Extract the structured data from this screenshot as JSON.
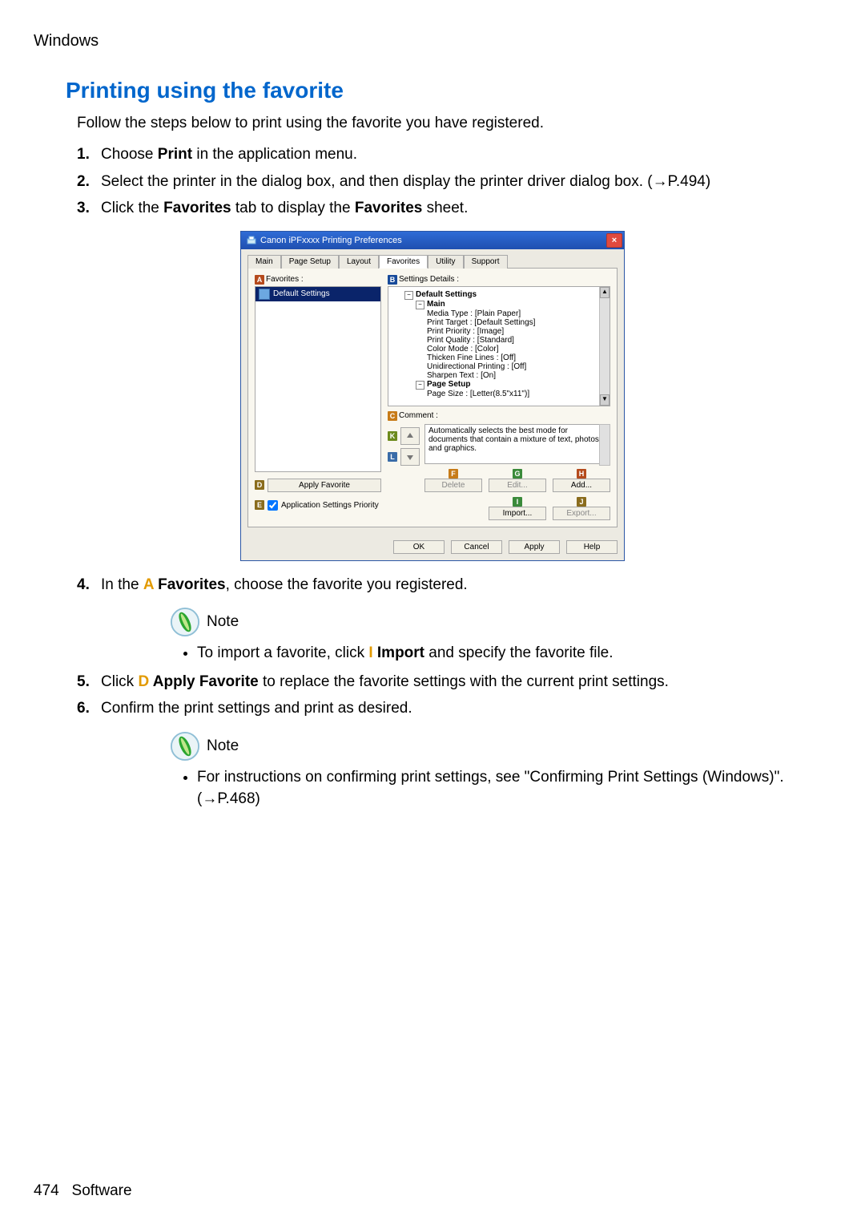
{
  "top_path": "Windows",
  "heading": "Printing using the favorite",
  "intro": "Follow the steps below to print using the favorite you have registered.",
  "steps": {
    "s1": {
      "num": "1.",
      "pre": "Choose ",
      "bold": "Print",
      "post": " in the application menu."
    },
    "s2": {
      "num": "2.",
      "text": "Select the printer in the dialog box, and then display the printer driver dialog box.  (",
      "arrow": "→P.494",
      "close": ")"
    },
    "s3": {
      "num": "3.",
      "pre": "Click the ",
      "b1": "Favorites",
      "mid": " tab to display the ",
      "b2": "Favorites",
      "post": " sheet."
    },
    "s4": {
      "num": "4.",
      "pre": "In the ",
      "markerA": "A",
      "b": " Favorites",
      "post": ", choose the favorite you registered."
    },
    "s5": {
      "num": "5.",
      "pre": "Click ",
      "markerD": "D",
      "b": " Apply Favorite",
      "post": " to replace the favorite settings with the current print settings."
    },
    "s6": {
      "num": "6.",
      "text": "Confirm the print settings and print as desired."
    }
  },
  "notes": {
    "label": "Note",
    "n1": {
      "pre": "To import a favorite, click ",
      "markerI": "I",
      "b": " Import",
      "post": " and specify the favorite file."
    },
    "n2": {
      "pre": "For instructions on confirming print settings, see \"Confirming Print Settings (Windows)\".  (",
      "arrow": "→P.468",
      "close": ")"
    }
  },
  "footer": {
    "page": "474",
    "section": "Software"
  },
  "dialog": {
    "title": "Canon iPFxxxx Printing Preferences",
    "tabs": [
      "Main",
      "Page Setup",
      "Layout",
      "Favorites",
      "Utility",
      "Support"
    ],
    "active_tab_index": 3,
    "labels": {
      "favorites": "Favorites :",
      "settings_details": "Settings Details :",
      "comment": "Comment :",
      "apply_favorite": "Apply Favorite",
      "app_settings_priority": "Application Settings Priority"
    },
    "markers": {
      "A": "A",
      "B": "B",
      "C": "C",
      "D": "D",
      "E": "E",
      "F": "F",
      "G": "G",
      "H": "H",
      "I": "I",
      "J": "J",
      "K": "K",
      "L": "L"
    },
    "favorites_list": [
      "Default Settings"
    ],
    "tree": {
      "root": "Default Settings",
      "main": "Main",
      "leaves": [
        "Media Type : [Plain Paper]",
        "Print Target : [Default Settings]",
        "Print Priority : [Image]",
        "Print Quality : [Standard]",
        "Color Mode : [Color]",
        "Thicken Fine Lines : [Off]",
        "Unidirectional Printing : [Off]",
        "Sharpen Text : [On]"
      ],
      "page_setup": "Page Setup",
      "page_size": "Page Size : [Letter(8.5\"x11\")]"
    },
    "comment_text": "Automatically selects the best mode for documents that contain a mixture of text, photos, and graphics.",
    "buttons": {
      "delete": "Delete",
      "edit": "Edit...",
      "add": "Add...",
      "import": "Import...",
      "export": "Export...",
      "ok": "OK",
      "cancel": "Cancel",
      "apply": "Apply",
      "help": "Help"
    },
    "icons": {
      "close": "×",
      "up": "▲",
      "down": "▼",
      "boxminus": "−"
    }
  }
}
